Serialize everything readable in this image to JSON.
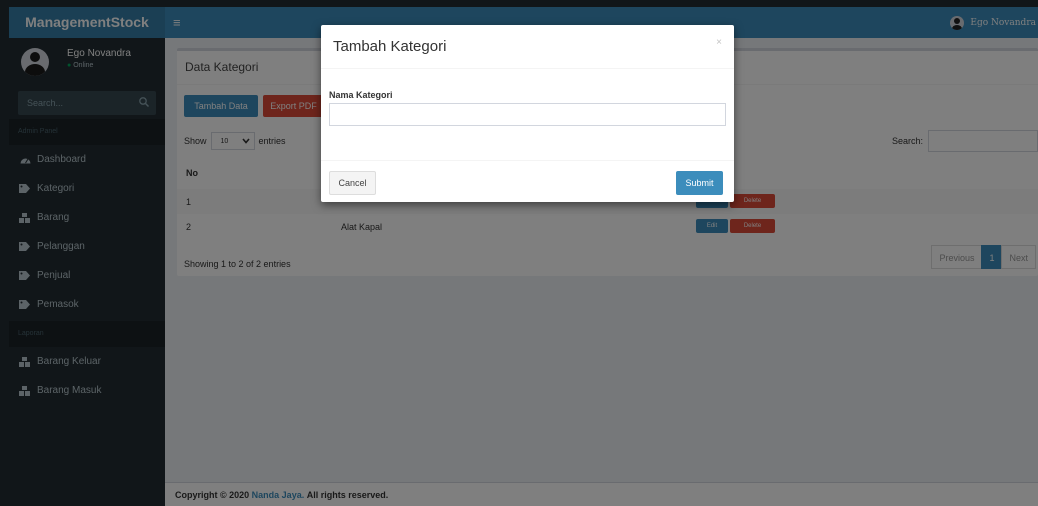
{
  "app": {
    "logo": "ManagementStock",
    "toggle_icon": "≡"
  },
  "navbar": {
    "user_name": "Ego Novandra"
  },
  "sidebar": {
    "user_name": "Ego Novandra",
    "user_status_dot": "●",
    "user_status": "Online",
    "search_placeholder": "Search...",
    "section_admin": "Admin Panel",
    "items": [
      {
        "label": "Dashboard",
        "icon": "dashboard-icon"
      },
      {
        "label": "Kategori",
        "icon": "tag-icon"
      },
      {
        "label": "Barang",
        "icon": "cubes-icon"
      },
      {
        "label": "Pelanggan",
        "icon": "tag-icon"
      },
      {
        "label": "Penjual",
        "icon": "tag-icon"
      },
      {
        "label": "Pemasok",
        "icon": "tag-icon"
      }
    ],
    "section_laporan": "Laporan",
    "report_items": [
      {
        "label": "Barang Keluar",
        "icon": "cubes-icon"
      },
      {
        "label": "Barang Masuk",
        "icon": "cubes-icon"
      }
    ]
  },
  "main": {
    "box_title": "Data Kategori",
    "btn_add": "Tambah Data",
    "btn_pdf": "Export PDF",
    "show_label": "Show",
    "show_value": "10",
    "entries_label": "entries",
    "search_label": "Search:",
    "col_no": "No",
    "rows": [
      {
        "no": "1",
        "name": ""
      },
      {
        "no": "2",
        "name": "Alat Kapal"
      }
    ],
    "edit_label": "Edit",
    "delete_label": "Delete",
    "info": "Showing 1 to 2 of 2 entries",
    "pager": {
      "prev": "Previous",
      "current": "1",
      "next": "Next"
    }
  },
  "footer": {
    "prefix": "Copyright © 2020",
    "author": "Nanda Jaya.",
    "suffix": "All rights reserved."
  },
  "modal": {
    "title": "Tambah Kategori",
    "close": "×",
    "field_label": "Nama Kategori",
    "field_value": "",
    "cancel": "Cancel",
    "submit": "Submit"
  },
  "colors": {
    "primary": "#3c8dbc",
    "danger": "#dd4b39",
    "success": "#00a65a",
    "sidebar": "#222d32"
  }
}
